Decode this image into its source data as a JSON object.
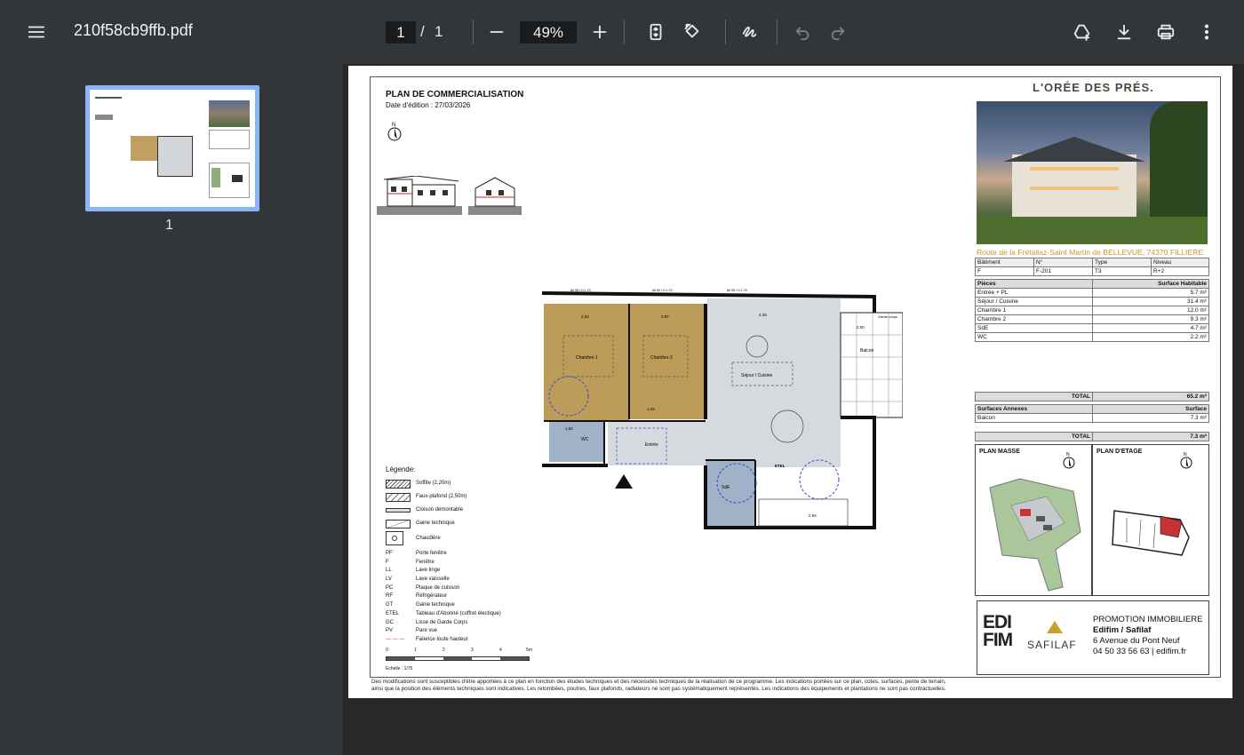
{
  "toolbar": {
    "file_name": "210f58cb9ffb.pdf",
    "current_page": "1",
    "separator": "/",
    "total_pages": "1",
    "zoom": "49%",
    "menu_icon": "menu-icon",
    "zoom_out_icon": "minus-icon",
    "zoom_in_icon": "plus-icon",
    "fit_icon": "fit-page-icon",
    "rotate_icon": "rotate-icon",
    "annotate_icon": "draw-icon",
    "undo_icon": "undo-icon",
    "redo_icon": "redo-icon",
    "drive_icon": "add-to-drive-icon",
    "download_icon": "download-icon",
    "print_icon": "print-icon",
    "more_icon": "more-vert-icon"
  },
  "sidebar": {
    "thumbnails": [
      {
        "page_label": "1"
      }
    ]
  },
  "document": {
    "title": "PLAN DE COMMERCIALISATION",
    "date_line": "Date d'édition :  27/03/2026",
    "brand": "L'ORÉE DES PRÉS.",
    "address": "Route de la Frétallaz-Saint Martin de BELLEVUE, 74370 FILLIERE",
    "lot_table": {
      "headers": [
        "Bâtiment",
        "N°",
        "Type",
        "Niveau"
      ],
      "values": [
        "F",
        "F-201",
        "T3",
        "R+2"
      ]
    },
    "rooms_table": {
      "header_left": "Pièces",
      "header_right": "Surface Habitable",
      "rows": [
        {
          "name": "Entrée + PL",
          "area": "5.7 m²"
        },
        {
          "name": "Séjour / Cuisine",
          "area": "31.4 m²"
        },
        {
          "name": "Chambre 1",
          "area": "12.0 m²"
        },
        {
          "name": "Chambre 2",
          "area": "9.3 m²"
        },
        {
          "name": "SdE",
          "area": "4.7 m²"
        },
        {
          "name": "WC",
          "area": "2.2 m²"
        }
      ],
      "total_label": "TOTAL",
      "total_value": "65.2 m²"
    },
    "annex_table": {
      "header_left": "Surfaces Annexes",
      "header_right": "Surface",
      "rows": [
        {
          "name": "Balcon",
          "area": "7.3 m²"
        }
      ],
      "total_label": "TOTAL",
      "total_value": "7.3 m²"
    },
    "plan_masse_label": "PLAN MASSE",
    "plan_etage_label": "PLAN D'ETAGE",
    "north_label": "N",
    "promo": {
      "logo1_line1": "EDI",
      "logo1_line2": "FIM",
      "logo2": "SAFILAF",
      "line1": "PROMOTION IMMOBILIERE",
      "line2": "Edifim / Safilaf",
      "line3": "6 Avenue du Pont Neuf",
      "line4": "04 50 33 56 63 | edifim.fr"
    },
    "legend": {
      "title": "Légende:",
      "swatches": [
        "Soffite (2,20m)",
        "Faux-plafond (2,50m)",
        "Cloison démontable",
        "Gaine technique",
        "Chaudière"
      ],
      "abbreviations": [
        {
          "code": "PF",
          "label": "Porte fenêtre"
        },
        {
          "code": "F",
          "label": "Fenêtre"
        },
        {
          "code": "LL",
          "label": "Lave linge"
        },
        {
          "code": "LV",
          "label": "Lave vaisselle"
        },
        {
          "code": "PC",
          "label": "Plaque de cuisson"
        },
        {
          "code": "RF",
          "label": "Réfrigérateur"
        },
        {
          "code": "GT",
          "label": "Gaine technique"
        },
        {
          "code": "ETEL",
          "label": "Tableau d'Abonné (coffret électique)"
        },
        {
          "code": "GC",
          "label": "Lisse de Garde Corps"
        },
        {
          "code": "PV",
          "label": "Pare vue"
        },
        {
          "code": "",
          "label": "Faïence toute hauteur"
        }
      ]
    },
    "scale": {
      "ticks": [
        "0",
        "1",
        "2",
        "3",
        "4",
        "5m"
      ],
      "label": "Echelle : 1/75"
    },
    "plan_labels": {
      "chambre1": "Chambre 1",
      "chambre2": "Chambre 2",
      "sejour": "Séjour / Cuisine",
      "balcon": "Balcon",
      "entree": "Entrée",
      "wc": "WC",
      "sde": "SdE",
      "etel": "ETEL",
      "garde_corps": "Garde corps",
      "dim_a": "3.92",
      "dim_b": "2.97",
      "dim_c": "4.26",
      "dim_d": "2.00",
      "dim_e": "1.92",
      "dim_f": "2.94",
      "dim_g": "1.26",
      "win1": "All 95 / H 1.70",
      "win2": "All 60 / H 1.70",
      "win3": "All 90 / H 1.75"
    },
    "footer_line1": "Des modifications sont susceptibles d'être apportées à ce plan en fonction des études techniques et des nécessités techniques de la réalisation de ce programme.   Les indications portées sur ce plan, cotes, surfaces, pente de terrain,",
    "footer_line2": "ainsi que la position des éléments techniques sont indicatives.  Les retombées, poutres, faux plafonds, radiateurs ne sont pas systématiquement représentés. Les indications des équipements et plantations ne sont pas contractuelles."
  }
}
